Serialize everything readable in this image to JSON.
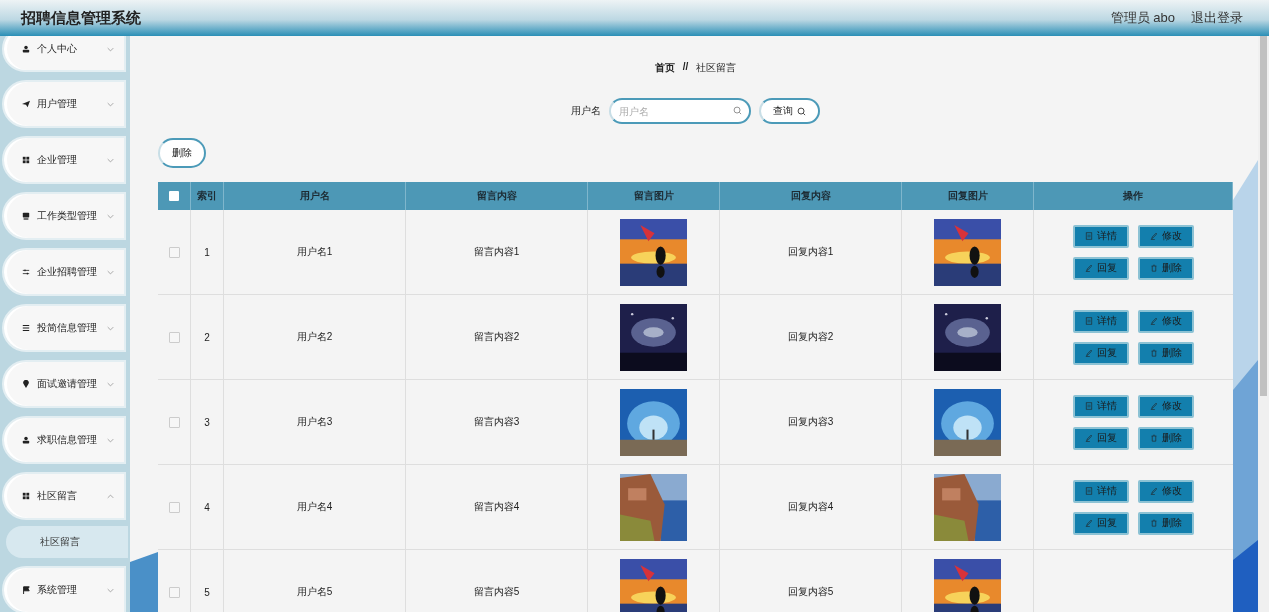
{
  "header": {
    "title": "招聘信息管理系统",
    "user": "管理员 abo",
    "logout": "退出登录"
  },
  "sidebar": {
    "items": [
      {
        "label": "个人中心",
        "expanded": false
      },
      {
        "label": "用户管理",
        "expanded": false
      },
      {
        "label": "企业管理",
        "expanded": false
      },
      {
        "label": "工作类型管理",
        "expanded": false
      },
      {
        "label": "企业招聘管理",
        "expanded": false
      },
      {
        "label": "投简信息管理",
        "expanded": false
      },
      {
        "label": "面试邀请管理",
        "expanded": false
      },
      {
        "label": "求职信息管理",
        "expanded": false
      },
      {
        "label": "社区留言",
        "expanded": true,
        "children": [
          {
            "label": "社区留言"
          }
        ]
      },
      {
        "label": "系统管理",
        "expanded": false
      }
    ]
  },
  "breadcrumb": {
    "home": "首页",
    "separator": "//",
    "current": "社区留言"
  },
  "search": {
    "label": "用户名",
    "placeholder": "用户名",
    "button": "查询"
  },
  "delete_button": "删除",
  "table": {
    "select_all_checked": false,
    "columns": [
      "索引",
      "用户名",
      "留言内容",
      "留言图片",
      "回复内容",
      "回复图片",
      "操作"
    ],
    "rows": [
      {
        "index": "1",
        "username": "用户名1",
        "content": "留言内容1",
        "reply": "回复内容1",
        "checked": false,
        "actions": [
          "详情",
          "修改",
          "回复",
          "删除"
        ]
      },
      {
        "index": "2",
        "username": "用户名2",
        "content": "留言内容2",
        "reply": "回复内容2",
        "checked": false,
        "actions": [
          "详情",
          "修改",
          "回复",
          "删除"
        ]
      },
      {
        "index": "3",
        "username": "用户名3",
        "content": "留言内容3",
        "reply": "回复内容3",
        "checked": false,
        "actions": [
          "详情",
          "修改",
          "回复",
          "删除"
        ]
      },
      {
        "index": "4",
        "username": "用户名4",
        "content": "留言内容4",
        "reply": "回复内容4",
        "checked": false,
        "actions": [
          "详情",
          "修改",
          "回复",
          "删除"
        ]
      },
      {
        "index": "5",
        "username": "用户名5",
        "content": "留言内容5",
        "reply": "回复内容5",
        "checked": false
      }
    ]
  }
}
